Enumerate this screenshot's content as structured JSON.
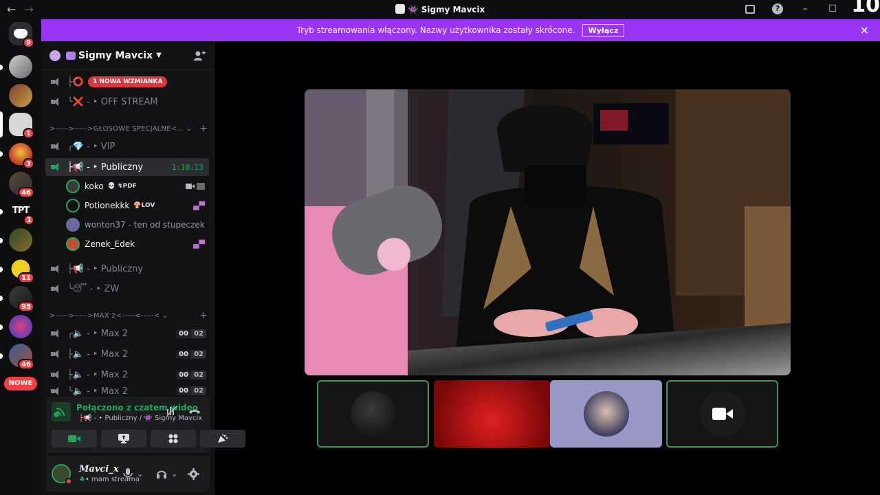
{
  "window": {
    "title": "Sigmy Mavcix",
    "corner_number": "10"
  },
  "banner": {
    "text": "Tryb streamowania włączony. Nazwy użytkownika zostały skrócone.",
    "button": "Wyłącz"
  },
  "rail": {
    "home_badge": "9",
    "badges": [
      "1",
      "3",
      "46",
      "1",
      "11",
      "95",
      "46"
    ],
    "tpt_label": "TPT",
    "nowe_label": "NOWE"
  },
  "server": {
    "name": "Sigmy Mavcix"
  },
  "channels": {
    "top": [
      {
        "prefix": "├⭕",
        "name": "",
        "mention": "1 NOWA WZMIANKA"
      },
      {
        "prefix": "╰❌ - ‣",
        "name": "OFF STREAM"
      }
    ],
    "category1": ">----->----->GŁOSOWE SPECJALNE<...",
    "cat1_items": [
      {
        "prefix": "╭💎 - ‣",
        "name": "VIP"
      },
      {
        "prefix": "├📢 - ‣",
        "name": "Publiczny",
        "timer": "1:10:13"
      }
    ],
    "voice_users": [
      {
        "name": "koko",
        "tag": "💀 ↯PDF"
      },
      {
        "name": "Potionekkk",
        "tag": "🍄LOV"
      },
      {
        "name": "wonton37 - ten od stupeczek",
        "tag": ""
      },
      {
        "name": "Zenek_Edek",
        "tag": ""
      }
    ],
    "cat1_after": [
      {
        "prefix": "├📢 - ‣",
        "name": "Publiczny"
      },
      {
        "prefix": "╰😴 - ‣",
        "name": "ZW"
      }
    ],
    "category2": ">----->----->MAX 2<-----<-----<",
    "cat2_items": [
      {
        "prefix": "╭🔈 - ‣",
        "name": "Max 2",
        "count": "00",
        "limit": "02"
      },
      {
        "prefix": "├🔈 - ‣",
        "name": "Max 2",
        "count": "00",
        "limit": "02"
      },
      {
        "prefix": "├🔈 - ‣",
        "name": "Max 2",
        "count": "00",
        "limit": "02"
      },
      {
        "prefix": "╰🔈 - ‣",
        "name": "Max 2",
        "count": "00",
        "limit": "02"
      }
    ]
  },
  "voice_panel": {
    "title": "Połączono z czatem wideo",
    "subtitle": "├📢 - ‣ Publiczny / 👾 Sigmy Mavcix"
  },
  "user_panel": {
    "name": "Mavci_x",
    "status": "• mam streama"
  },
  "colors": {
    "accent_green": "#23a55a",
    "banner_purple": "#9b35f4",
    "badge_red": "#f23f43"
  }
}
